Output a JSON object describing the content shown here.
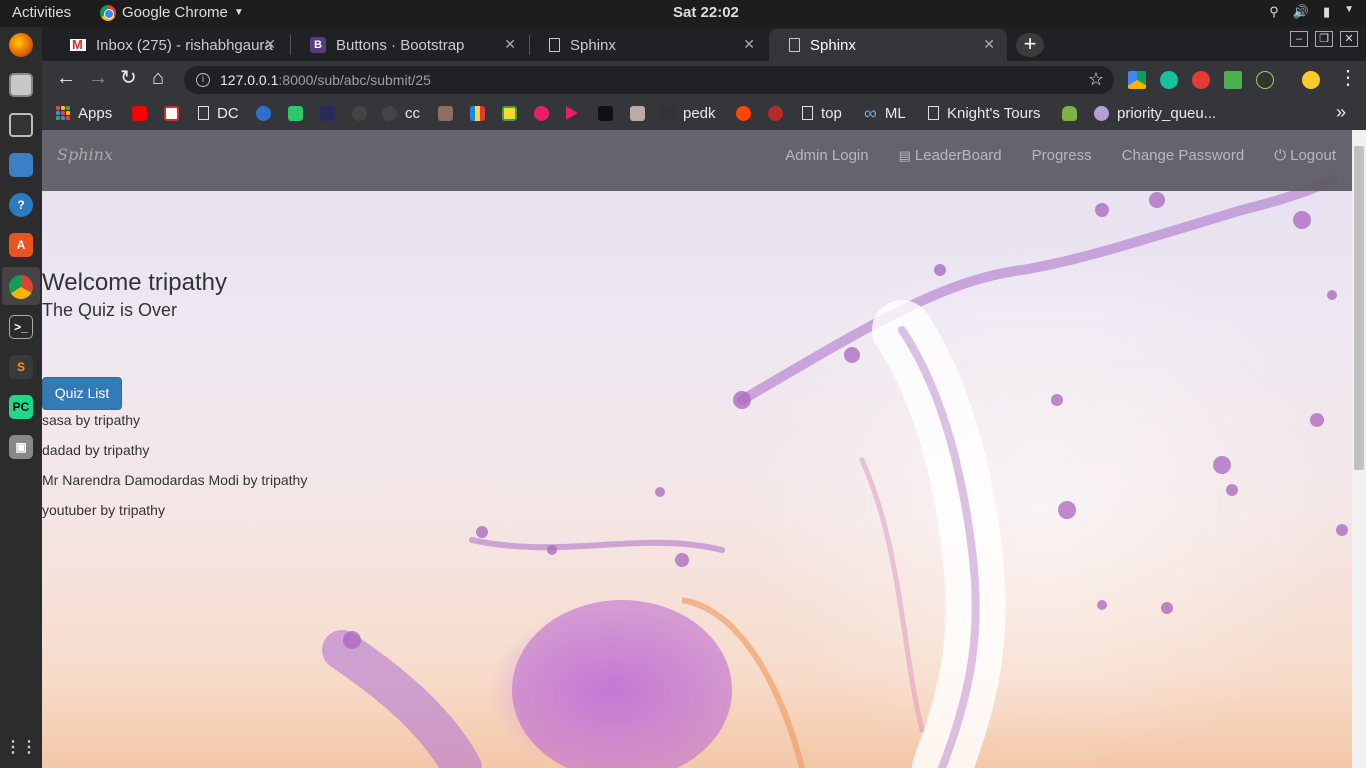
{
  "system": {
    "activities": "Activities",
    "app_name": "Google Chrome",
    "clock": "Sat 22:02"
  },
  "tabs": [
    {
      "title": "Inbox (275) - rishabhgaura",
      "favicon": "gmail-icon"
    },
    {
      "title": "Buttons · Bootstrap",
      "favicon": "bootstrap-icon"
    },
    {
      "title": "Sphinx",
      "favicon": "page-icon"
    },
    {
      "title": "Sphinx",
      "favicon": "page-icon",
      "active": true
    }
  ],
  "address": {
    "host": "127.0.0.1",
    "rest": ":8000/sub/abc/submit/25"
  },
  "bookmarks": [
    {
      "label": "Apps"
    },
    {
      "label": "DC"
    },
    {
      "label": "cc"
    },
    {
      "label": "pedk"
    },
    {
      "label": "top"
    },
    {
      "label": "ML"
    },
    {
      "label": "Knight's Tours"
    },
    {
      "label": "priority_queu..."
    }
  ],
  "site": {
    "brand": "Sphinx",
    "nav": [
      "Admin Login",
      "LeaderBoard",
      "Progress",
      "Change Password",
      "Logout"
    ],
    "welcome": "Welcome tripathy",
    "status": "The Quiz is Over",
    "button": "Quiz List",
    "quizzes": [
      "sasa by tripathy",
      "dadad by tripathy",
      "Mr Narendra Damodardas Modi by tripathy",
      "youtuber by tripathy"
    ]
  },
  "colors": {
    "primary_button": "#337ab7",
    "navbar": "#5a5860",
    "chrome_dark": "#35363a"
  }
}
